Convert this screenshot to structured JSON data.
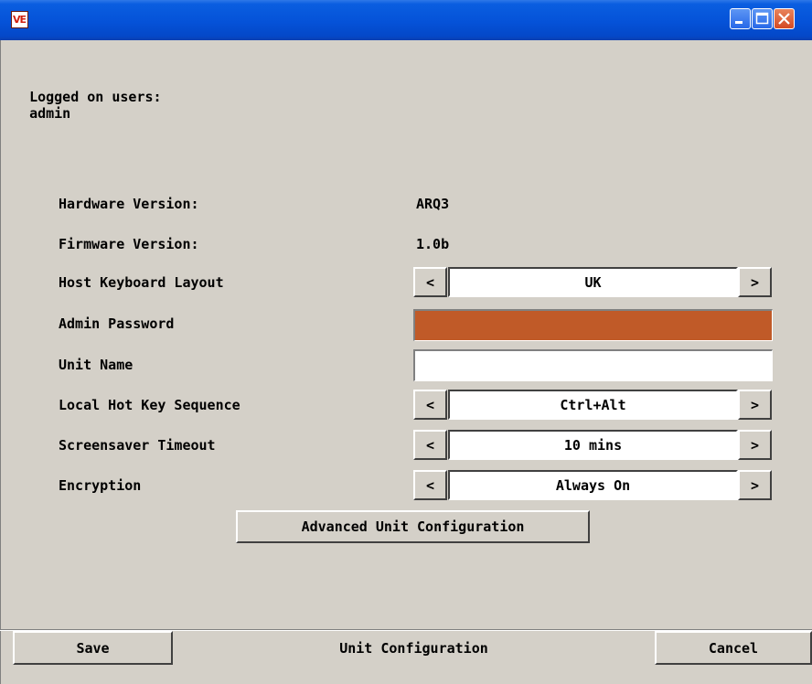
{
  "titlebar": {
    "app_icon_text": "VE",
    "icons": {
      "minimize": "minimize-icon",
      "maximize": "maximize-icon",
      "close": "close-icon"
    }
  },
  "header": {
    "logged_on_label": "Logged on users:",
    "logged_on_user": "admin"
  },
  "info": {
    "hardware_version_label": "Hardware Version:",
    "hardware_version_value": "ARQ3",
    "firmware_version_label": "Firmware Version:",
    "firmware_version_value": "1.0b"
  },
  "settings": {
    "host_keyboard_layout_label": "Host Keyboard Layout",
    "host_keyboard_layout_value": "UK",
    "admin_password_label": "Admin Password",
    "admin_password_value": "",
    "unit_name_label": "Unit Name",
    "unit_name_value": "",
    "local_hot_key_label": "Local Hot Key Sequence",
    "local_hot_key_value": "Ctrl+Alt",
    "screensaver_timeout_label": "Screensaver Timeout",
    "screensaver_timeout_value": "10 mins",
    "encryption_label": "Encryption",
    "encryption_value": "Always On",
    "prev_arrow": "<",
    "next_arrow": ">"
  },
  "buttons": {
    "advanced_unit_configuration": "Advanced Unit Configuration",
    "save": "Save",
    "cancel": "Cancel"
  },
  "footer": {
    "caption": "Unit Configuration"
  },
  "colors": {
    "titlebar_blue": "#0552d8",
    "window_gray": "#d4d0c8",
    "password_field": "#c05a28",
    "close_button_red": "#d44a24"
  }
}
